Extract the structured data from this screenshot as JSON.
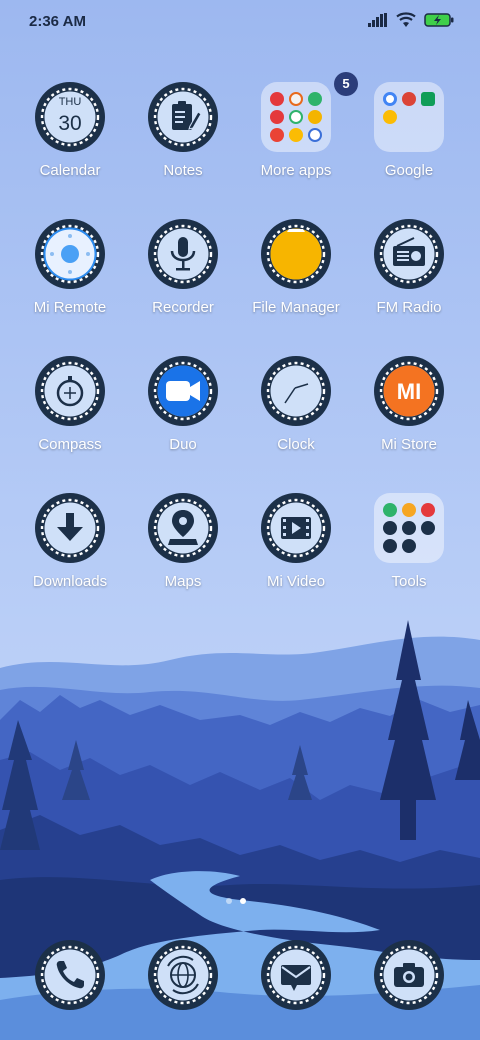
{
  "status": {
    "time": "2:36 AM"
  },
  "rows": [
    [
      {
        "name": "calendar",
        "label": "Calendar",
        "day": "THU",
        "date": "30"
      },
      {
        "name": "notes",
        "label": "Notes"
      },
      {
        "name": "more-apps",
        "label": "More apps",
        "badge": "5"
      },
      {
        "name": "google",
        "label": "Google"
      }
    ],
    [
      {
        "name": "mi-remote",
        "label": "Mi Remote"
      },
      {
        "name": "recorder",
        "label": "Recorder"
      },
      {
        "name": "file-manager",
        "label": "File Manager"
      },
      {
        "name": "fm-radio",
        "label": "FM Radio"
      }
    ],
    [
      {
        "name": "compass",
        "label": "Compass"
      },
      {
        "name": "duo",
        "label": "Duo"
      },
      {
        "name": "clock",
        "label": "Clock"
      },
      {
        "name": "mi-store",
        "label": "Mi Store",
        "glyph": "MI"
      }
    ],
    [
      {
        "name": "downloads",
        "label": "Downloads"
      },
      {
        "name": "maps",
        "label": "Maps"
      },
      {
        "name": "mi-video",
        "label": "Mi Video"
      },
      {
        "name": "tools",
        "label": "Tools"
      }
    ]
  ],
  "page_indicator": {
    "count": 2,
    "active": 1
  },
  "dock": [
    {
      "name": "phone"
    },
    {
      "name": "browser"
    },
    {
      "name": "messages"
    },
    {
      "name": "camera"
    }
  ],
  "colors": {
    "ring_dark": "#1c3048",
    "ring_light": "#cfe0f8",
    "accent_orange": "#f47321",
    "accent_yellow": "#f7b500",
    "duo_blue": "#1a73e8"
  }
}
